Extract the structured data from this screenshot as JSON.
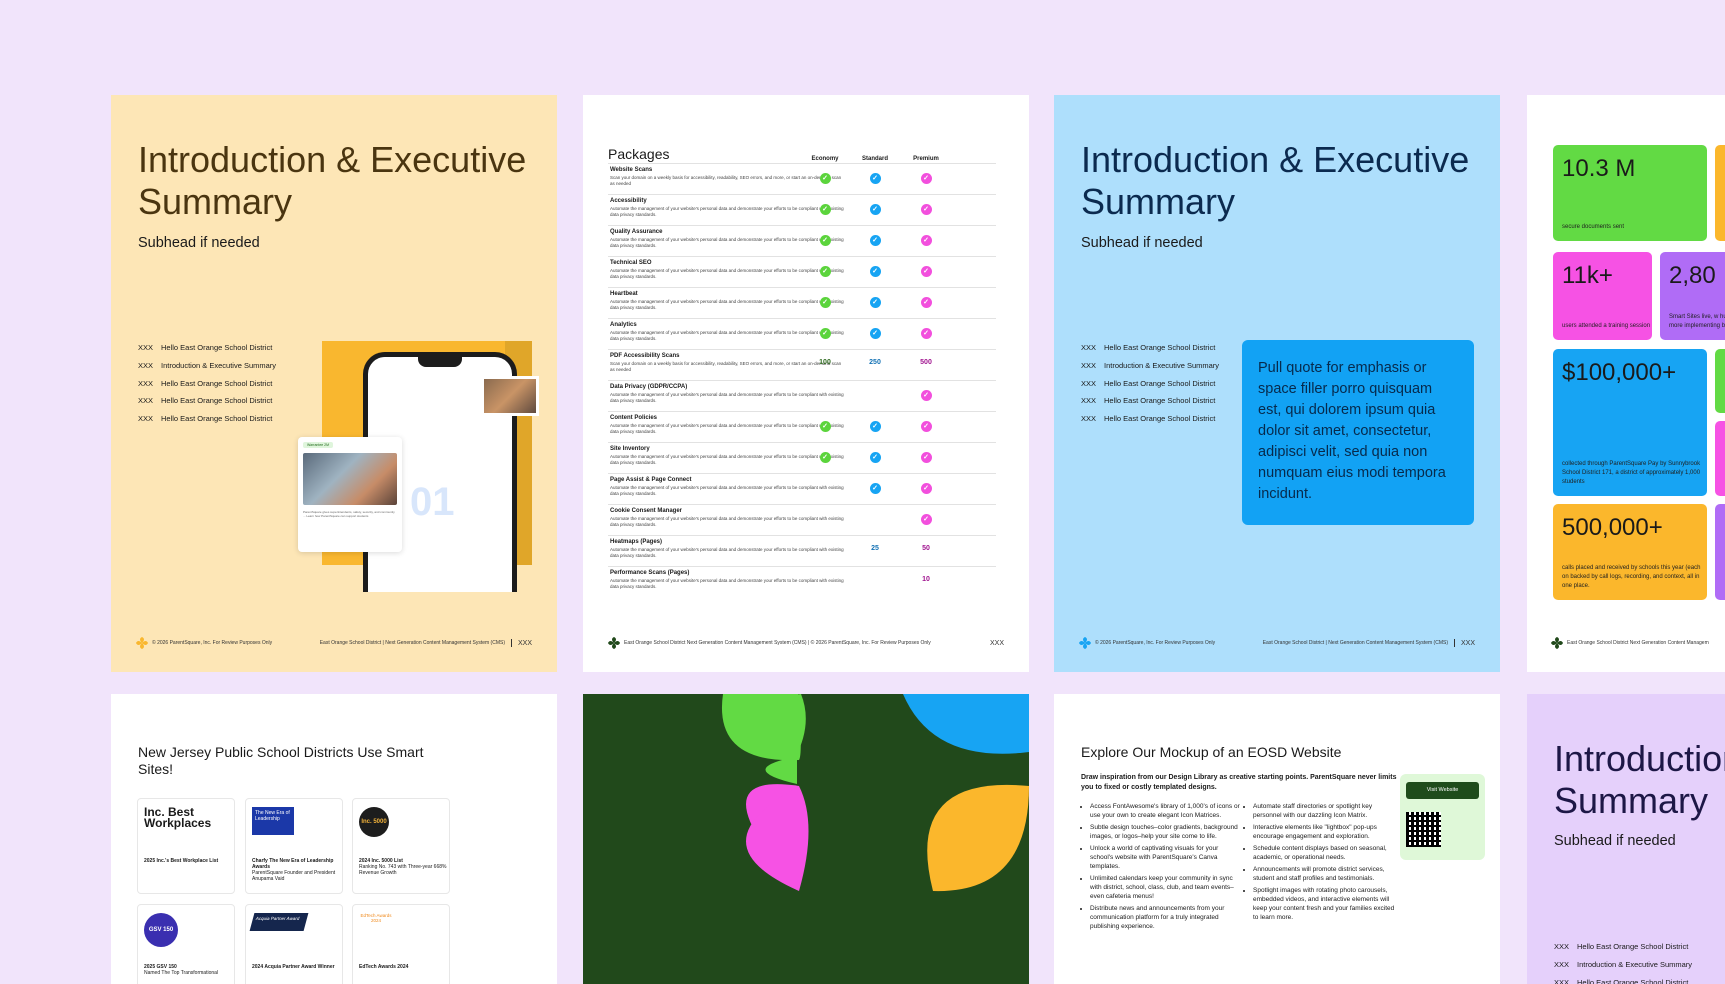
{
  "p1": {
    "title": "Introduction & Executive Summary",
    "subhead": "Subhead if needed",
    "toc": [
      {
        "num": "XXX",
        "label": "Hello East Orange School District"
      },
      {
        "num": "XXX",
        "label": "Introduction & Executive Summary"
      },
      {
        "num": "XXX",
        "label": "Hello East Orange School District"
      },
      {
        "num": "XXX",
        "label": "Hello East Orange School District"
      },
      {
        "num": "XXX",
        "label": "Hello East Orange School District"
      }
    ],
    "section_number": "01",
    "card_tag": "Warrantee 2M",
    "card_text": "ParentSquare gives superintendents, safety, security, and community ... Learn how ParentSquare can support students",
    "footer_left": "© 2026 ParentSquare, Inc. For Review Purposes Only",
    "footer_right": "East Orange School District | Next Generation Content Management System (CMS)",
    "page_num": "XXX"
  },
  "p2": {
    "title": "Packages",
    "headers": [
      "Economy",
      "Standard",
      "Premium"
    ],
    "rows": [
      {
        "name": "Website Scans",
        "desc": "Scan your domain on a weekly basis for accessibility, readability, SEO errors, and more, or start an on-demand scan as needed",
        "cells": [
          "check",
          "check",
          "check"
        ]
      },
      {
        "name": "Accessibility",
        "desc": "Automate the management of your website's personal data and demonstrate your efforts to be compliant with existing data privacy standards.",
        "cells": [
          "check",
          "check",
          "check"
        ]
      },
      {
        "name": "Quality Assurance",
        "desc": "Automate the management of your website's personal data and demonstrate your efforts to be compliant with existing data privacy standards.",
        "cells": [
          "check",
          "check",
          "check"
        ]
      },
      {
        "name": "Technical SEO",
        "desc": "Automate the management of your website's personal data and demonstrate your efforts to be compliant with existing data privacy standards.",
        "cells": [
          "check",
          "check",
          "check"
        ]
      },
      {
        "name": "Heartbeat",
        "desc": "Automate the management of your website's personal data and demonstrate your efforts to be compliant with existing data privacy standards.",
        "cells": [
          "check",
          "check",
          "check"
        ]
      },
      {
        "name": "Analytics",
        "desc": "Automate the management of your website's personal data and demonstrate your efforts to be compliant with existing data privacy standards.",
        "cells": [
          "check",
          "check",
          "check"
        ]
      },
      {
        "name": "PDF Accessibility Scans",
        "desc": "Scan your domain on a weekly basis for accessibility, readability, SEO errors, and more, or start an on-demand scan as needed",
        "cells": [
          "100",
          "250",
          "500"
        ]
      },
      {
        "name": "Data Privacy (GDPR/CCPA)",
        "desc": "Automate the management of your website's personal data and demonstrate your efforts to be compliant with existing data privacy standards.",
        "cells": [
          "",
          "",
          "check"
        ]
      },
      {
        "name": "Content Policies",
        "desc": "Automate the management of your website's personal data and demonstrate your efforts to be compliant with existing data privacy standards.",
        "cells": [
          "check",
          "check",
          "check"
        ]
      },
      {
        "name": "Site Inventory",
        "desc": "Automate the management of your website's personal data and demonstrate your efforts to be compliant with existing data privacy standards.",
        "cells": [
          "check",
          "check",
          "check"
        ]
      },
      {
        "name": "Page Assist & Page Connect",
        "desc": "Automate the management of your website's personal data and demonstrate your efforts to be compliant with existing data privacy standards.",
        "cells": [
          "",
          "check",
          "check"
        ]
      },
      {
        "name": "Cookie Consent Manager",
        "desc": "Automate the management of your website's personal data and demonstrate your efforts to be compliant with existing data privacy standards.",
        "cells": [
          "",
          "",
          "check"
        ]
      },
      {
        "name": "Heatmaps (Pages)",
        "desc": "Automate the management of your website's personal data and demonstrate your efforts to be compliant with existing data privacy standards.",
        "cells": [
          "",
          "25",
          "50"
        ]
      },
      {
        "name": "Performance Scans (Pages)",
        "desc": "Automate the management of your website's personal data and demonstrate your efforts to be compliant with existing data privacy standards.",
        "cells": [
          "",
          "",
          "10"
        ]
      }
    ],
    "footer": "East Orange School District Next Generation Content Management System (CMS) | © 2026 ParentSquare, Inc. For Review Purposes Only",
    "page_num": "XXX"
  },
  "p3": {
    "title": "Introduction & Executive Summary",
    "subhead": "Subhead if needed",
    "toc": [
      {
        "num": "XXX",
        "label": "Hello East Orange School District"
      },
      {
        "num": "XXX",
        "label": "Introduction & Executive Summary"
      },
      {
        "num": "XXX",
        "label": "Hello East Orange School District"
      },
      {
        "num": "XXX",
        "label": "Hello East Orange School District"
      },
      {
        "num": "XXX",
        "label": "Hello East Orange School District"
      }
    ],
    "quote": "Pull quote for emphasis or space filler porro quisquam est, qui dolorem ipsum quia dolor sit amet, consectetur, adipisci velit, sed quia non numquam eius modi tempora incidunt.",
    "footer_left": "© 2026 ParentSquare, Inc. For Review Purposes Only",
    "footer_right": "East Orange School District | Next Generation Content Management System (CMS)",
    "page_num": "XXX"
  },
  "p4": {
    "stats": [
      {
        "value": "10.3 M",
        "desc": "secure documents sent",
        "color": "#62da44"
      },
      {
        "value": "11k+",
        "desc": "users attended a training session",
        "color": "#f652e4"
      },
      {
        "value": "2,80",
        "desc": "Smart Sites live, w hundreds more implementing befo",
        "color": "#b06cf6"
      },
      {
        "value": "$100,000+",
        "desc": "collected through ParentSquare Pay by Sunnybrook School District 171, a district of approximately 1,000 students",
        "color": "#17a4f3"
      },
      {
        "value": "500,000+",
        "desc": "calls placed and received by schools this year (each on backed by call logs, recording, and context, all in one place.",
        "color": "#fbb72c"
      }
    ],
    "footer": "East Orange School District Next Generation Content Managem"
  },
  "p5": {
    "title": "New Jersey Public School Districts Use Smart Sites!",
    "awards": [
      {
        "logo": "Inc. Best Workplaces",
        "caption": "2025 Inc.'s Best Workplace List",
        "detail": ""
      },
      {
        "logo": "The New Era of Leadership",
        "caption": "Charfy The New Era of Leadership Awards",
        "detail": "ParentSquare Founder and President Anupama Vaid"
      },
      {
        "logo": "Inc. 5000",
        "caption": "2024 Inc. 5000 List",
        "detail": "Ranking No. 743 with Three-year 668% Revenue Growth"
      },
      {
        "logo": "GSV 150",
        "caption": "2025 GSV 150",
        "detail": "Named The Top Transformational"
      },
      {
        "logo": "Acquia Partner Award",
        "caption": "2024 Acquia Partner Award Winner",
        "detail": ""
      },
      {
        "logo": "EdTech Awards 2024",
        "caption": "EdTech Awards 2024",
        "detail": ""
      }
    ]
  },
  "p7": {
    "title": "Explore Our Mockup of an EOSD Website",
    "intro": "Draw inspiration from our Design Library as creative starting points. ParentSquare never limits you to fixed or costly templated designs.",
    "bullets_left": [
      "Access FontAwesome's library of 1,000's of icons or use your own to create elegant Icon Matrices.",
      "Subtle design touches–color gradients, background images, or logos–help your site come to life.",
      "Unlock a world of captivating visuals for your school's website with ParentSquare's Canva templates.",
      "Unlimited calendars keep your community in sync with district, school, class, club, and team events–even cafeteria menus!",
      "Distribute news and announcements from your communication platform for a truly integrated publishing experience."
    ],
    "bullets_right": [
      "Automate staff directories or spotlight key personnel with our dazzling Icon Matrix.",
      "Interactive elements like \"lightbox\" pop-ups encourage engagement and exploration.",
      "Schedule content displays based on seasonal, academic, or operational needs.",
      "Announcements will promote district services, student and staff profiles and testimonials.",
      "Spotlight images with rotating photo carousels, embedded videos, and interactive elements will keep your content fresh and your families excited to learn more."
    ],
    "visit_button": "Visit Website"
  },
  "p8": {
    "title": "Introduction & Executive Summary",
    "subhead": "Subhead if needed",
    "toc": [
      {
        "num": "XXX",
        "label": "Hello East Orange School District"
      },
      {
        "num": "XXX",
        "label": "Introduction & Executive Summary"
      },
      {
        "num": "XXX",
        "label": "Hello East Orange School District"
      }
    ]
  },
  "colors": {
    "background": "#f1e4fb",
    "yellow_page": "#fde6b6",
    "blue_page": "#aedffc",
    "green_page": "#21491b",
    "purple_page": "#e5d0fb",
    "economy": "#5bd43c",
    "standard": "#17a4f3",
    "premium": "#f24fdd"
  }
}
